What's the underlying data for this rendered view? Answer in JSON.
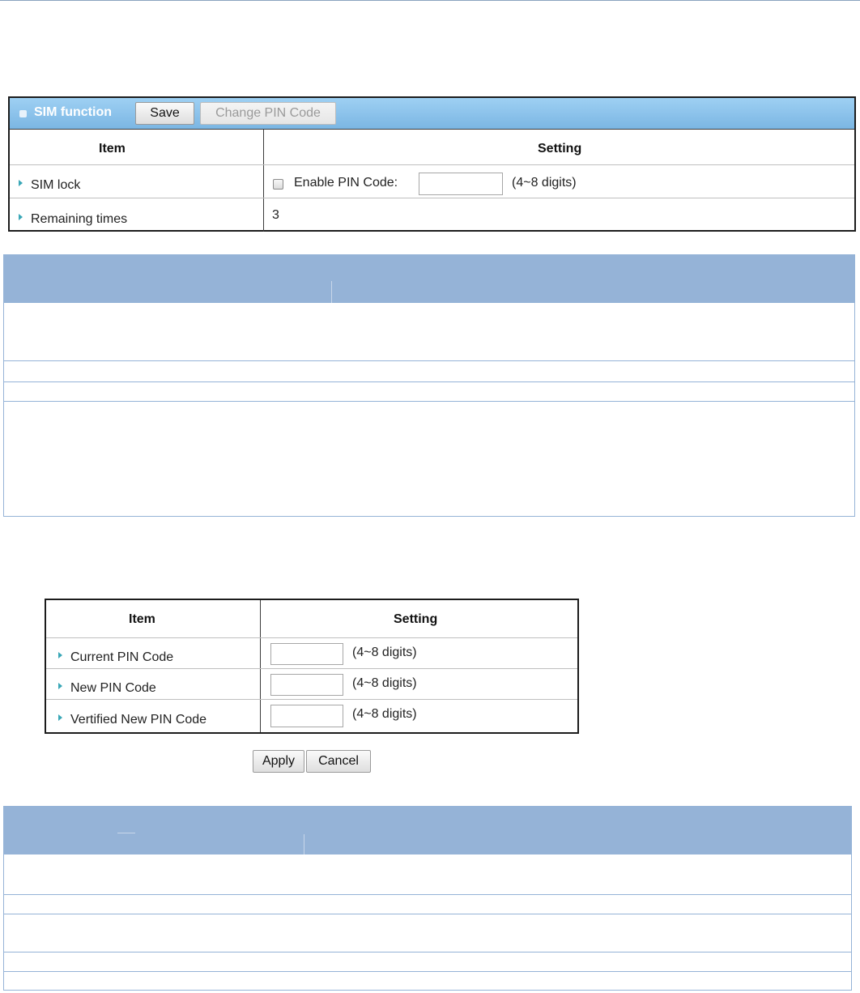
{
  "sim_panel": {
    "title": "SIM function",
    "save_label": "Save",
    "change_pin_label": "Change PIN Code",
    "columns": {
      "item": "Item",
      "setting": "Setting"
    },
    "rows": [
      {
        "label": "SIM lock",
        "checkbox_label": "Enable PIN Code:",
        "pin_value": "",
        "hint": "(4~8 digits)",
        "enabled": false
      },
      {
        "label": "Remaining times",
        "value": "3"
      }
    ]
  },
  "pin_panel": {
    "columns": {
      "item": "Item",
      "setting": "Setting"
    },
    "rows": [
      {
        "label": "Current PIN Code",
        "value": "",
        "hint": "(4~8 digits)"
      },
      {
        "label": "New PIN Code",
        "value": "",
        "hint": "(4~8 digits)"
      },
      {
        "label": "Vertified New PIN Code",
        "value": "",
        "hint": "(4~8 digits)"
      }
    ],
    "apply_label": "Apply",
    "cancel_label": "Cancel"
  },
  "colors": {
    "panel_header": "#7bb6e3",
    "desc_header": "#95b3d7",
    "bullet_arrow": "#3aa7b7"
  }
}
